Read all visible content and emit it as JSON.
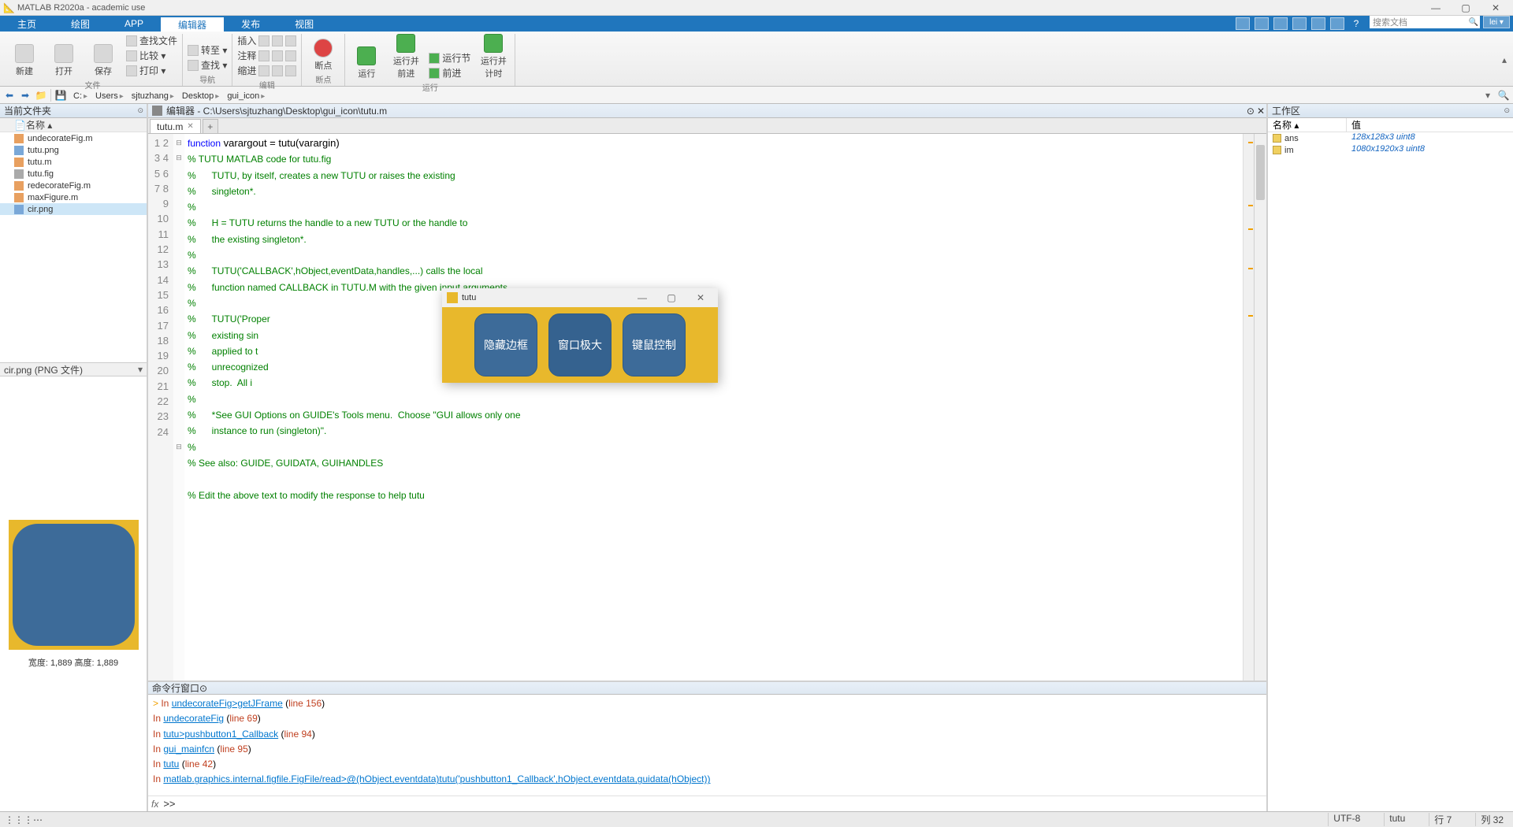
{
  "app": {
    "title": "MATLAB R2020a - academic use"
  },
  "ribbon_tabs": [
    "主页",
    "绘图",
    "APP",
    "编辑器",
    "发布",
    "视图"
  ],
  "ribbon_active_idx": 3,
  "search_placeholder": "搜索文档",
  "user_label": "lei ▾",
  "ribbon": {
    "file": {
      "label": "文件",
      "new": "新建",
      "open": "打开",
      "save": "保存",
      "findfiles": "查找文件",
      "compare": "比较 ▾",
      "print": "打印 ▾"
    },
    "nav": {
      "label": "导航",
      "goto": "转至 ▾",
      "find": "查找 ▾"
    },
    "edit": {
      "label": "编辑",
      "insert": "插入",
      "comment": "注释",
      "indent": "缩进"
    },
    "bp": {
      "label": "断点",
      "btn": "断点"
    },
    "run": {
      "label": "运行",
      "run": "运行",
      "runadv": "运行并\n前进",
      "runsec": "运行节",
      "advance": "前进",
      "runtime": "运行并\n计时"
    }
  },
  "path_crumbs": [
    "C:",
    "Users",
    "sjtuzhang",
    "Desktop",
    "gui_icon"
  ],
  "folder_panel_title": "当前文件夹",
  "folder_col": "名称 ▴",
  "files": [
    {
      "name": "undecorateFig.m",
      "type": "m"
    },
    {
      "name": "tutu.png",
      "type": "png"
    },
    {
      "name": "tutu.m",
      "type": "m"
    },
    {
      "name": "tutu.fig",
      "type": "fig"
    },
    {
      "name": "redecorateFig.m",
      "type": "m"
    },
    {
      "name": "maxFigure.m",
      "type": "m"
    },
    {
      "name": "cir.png",
      "type": "png"
    }
  ],
  "selected_file_idx": 6,
  "detail_label": "cir.png  (PNG 文件)",
  "preview_caption": "宽度: 1,889 高度: 1,889",
  "editor_title": "编辑器 - C:\\Users\\sjtuzhang\\Desktop\\gui_icon\\tutu.m",
  "editor_tab": "tutu.m",
  "code_lines": [
    {
      "n": 1,
      "kw": "function",
      "rest": " varargout = tutu(varargin)"
    },
    {
      "n": 2,
      "cm": "% TUTU MATLAB code for tutu.fig"
    },
    {
      "n": 3,
      "cm": "%      TUTU, by itself, creates a new TUTU or raises the existing"
    },
    {
      "n": 4,
      "cm": "%      singleton*."
    },
    {
      "n": 5,
      "cm": "%"
    },
    {
      "n": 6,
      "cm": "%      H = TUTU returns the handle to a new TUTU or the handle to"
    },
    {
      "n": 7,
      "cm": "%      the existing singleton*."
    },
    {
      "n": 8,
      "cm": "%"
    },
    {
      "n": 9,
      "cm": "%      TUTU('CALLBACK',hObject,eventData,handles,...) calls the local"
    },
    {
      "n": 10,
      "cm": "%      function named CALLBACK in TUTU.M with the given input arguments."
    },
    {
      "n": 11,
      "cm": "%"
    },
    {
      "n": 12,
      "cm": "%      TUTU('Proper"
    },
    {
      "n": 13,
      "cm": "%      existing sin"
    },
    {
      "n": 14,
      "cm": "%      applied to t"
    },
    {
      "n": 15,
      "cm": "%      unrecognized"
    },
    {
      "n": 16,
      "cm": "%      stop.  All i"
    },
    {
      "n": 17,
      "cm": "%"
    },
    {
      "n": 18,
      "cm": "%      *See GUI Options on GUIDE's Tools menu.  Choose \"GUI allows only one"
    },
    {
      "n": 19,
      "cm": "%      instance to run (singleton)\"."
    },
    {
      "n": 20,
      "cm": "%"
    },
    {
      "n": 21,
      "cm": "% See also: GUIDE, GUIDATA, GUIHANDLES"
    },
    {
      "n": 22,
      "cm": ""
    },
    {
      "n": 23,
      "cm": "% Edit the above text to modify the response to help tutu"
    },
    {
      "n": 24,
      "cm": ""
    }
  ],
  "cmd_panel_title": "命令行窗口",
  "cmd_lines": [
    {
      "pre": "  > ",
      "text": "In ",
      "link": "undecorateFig>getJFrame",
      "line": "line 156"
    },
    {
      "pre": "    ",
      "text": "In ",
      "link": "undecorateFig",
      "line": "line 69"
    },
    {
      "pre": "    ",
      "text": "In ",
      "link": "tutu>pushbutton1_Callback",
      "line": "line 94"
    },
    {
      "pre": "    ",
      "text": "In ",
      "link": "gui_mainfcn",
      "line": "line 95"
    },
    {
      "pre": "    ",
      "text": "In ",
      "link": "tutu",
      "line": "line 42"
    },
    {
      "pre": "    ",
      "text": "In ",
      "link": "matlab.graphics.internal.figfile.FigFile/read>@(hObject,eventdata)tutu('pushbutton1_Callback',hObject,eventdata,guidata(hObject))",
      "line": ""
    }
  ],
  "workspace_title": "工作区",
  "ws_cols": {
    "name": "名称 ▴",
    "value": "值"
  },
  "ws_rows": [
    {
      "name": "ans",
      "value": "128x128x3 uint8"
    },
    {
      "name": "im",
      "value": "1080x1920x3 uint8"
    }
  ],
  "status": {
    "encoding": "UTF-8",
    "script": "tutu",
    "row": "行   7",
    "col": "列   32"
  },
  "popup": {
    "title": "tutu",
    "buttons": [
      "隐藏边框",
      "窗口极大",
      "键鼠控制"
    ]
  }
}
